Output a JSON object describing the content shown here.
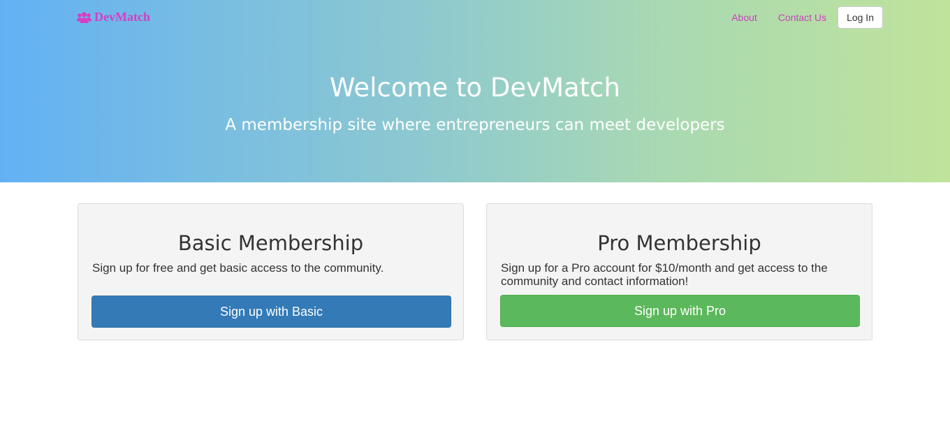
{
  "navbar": {
    "brand": "DevMatch",
    "brand_icon": "users-icon",
    "links": [
      "About",
      "Contact Us"
    ],
    "login_label": "Log In"
  },
  "hero": {
    "title": "Welcome to DevMatch",
    "subtitle": "A membership site where entrepreneurs can meet developers"
  },
  "plans": {
    "basic": {
      "title": "Basic Membership",
      "description": "Sign up for free and get basic access to the community.",
      "button_label": "Sign up with Basic"
    },
    "pro": {
      "title": "Pro Membership",
      "description": "Sign up for a Pro account for $10/month and get access to the community and contact information!",
      "button_label": "Sign up with Pro"
    }
  },
  "colors": {
    "brand": "#d63ec4",
    "gradient_start": "#63b1f4",
    "gradient_end": "#c0e39b",
    "basic_button": "#337ab7",
    "pro_button": "#5cb85c"
  }
}
